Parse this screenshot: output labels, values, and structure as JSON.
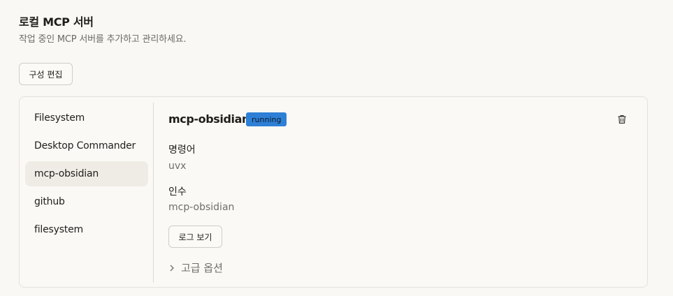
{
  "header": {
    "title": "로컬 MCP 서버",
    "subtitle": "작업 중인 MCP 서버를 추가하고 관리하세요."
  },
  "toolbar": {
    "edit_config_label": "구성 편집"
  },
  "sidebar": {
    "items": [
      {
        "label": "Filesystem",
        "active": false
      },
      {
        "label": "Desktop Commander",
        "active": false
      },
      {
        "label": "mcp-obsidian",
        "active": true
      },
      {
        "label": "github",
        "active": false
      },
      {
        "label": "filesystem",
        "active": false
      }
    ]
  },
  "detail": {
    "server_name": "mcp-obsidian",
    "status": "running",
    "status_color": "#2e7fd6",
    "delete_icon": "trash-icon",
    "command_label": "명령어",
    "command_value": "uvx",
    "args_label": "인수",
    "args_value": "mcp-obsidian",
    "logs_button": "로그 보기",
    "advanced_label": "고급 옵션",
    "advanced_icon": "chevron-right-icon"
  }
}
